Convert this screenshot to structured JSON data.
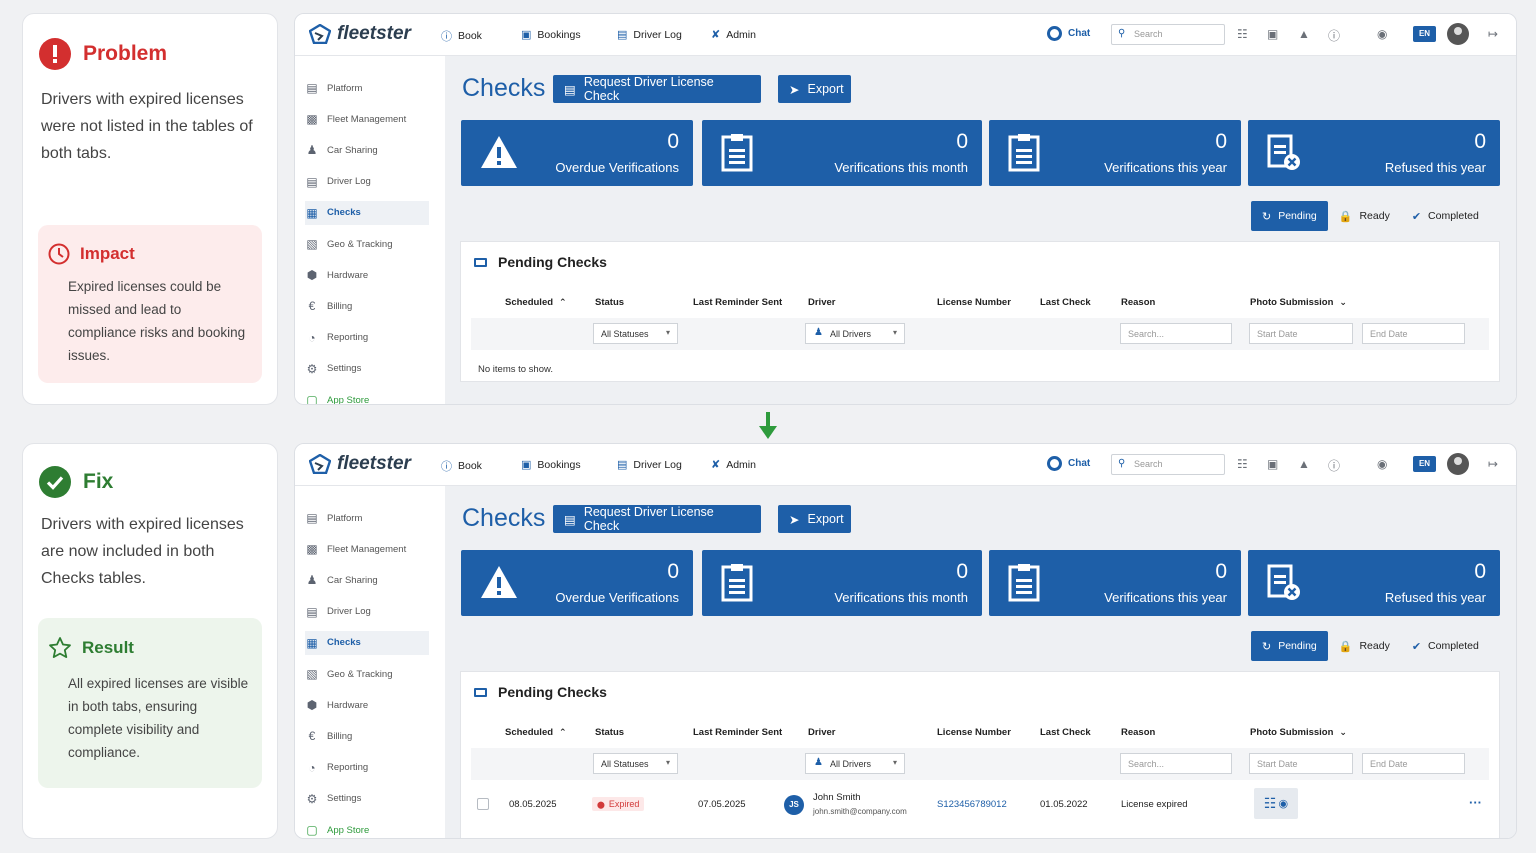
{
  "problem": {
    "title": "Problem",
    "body": "Drivers with expired licenses were not listed in the tables of both tabs.",
    "impact_title": "Impact",
    "impact_body": "Expired licenses could be missed and lead to compliance risks and booking issues."
  },
  "fix": {
    "title": "Fix",
    "body": "Drivers with expired licenses are now included in both Checks tables.",
    "result_title": "Result",
    "result_body": "All expired licenses are visible in both tabs, ensuring complete visibility and compliance."
  },
  "app": {
    "logo": "fleetster",
    "nav": [
      "Book",
      "Bookings",
      "Driver Log",
      "Admin"
    ],
    "chat": "Chat",
    "search_placeholder": "Search",
    "language": "EN",
    "sidebar": [
      "Platform",
      "Fleet Management",
      "Car Sharing",
      "Driver Log",
      "Checks",
      "Geo & Tracking",
      "Hardware",
      "Billing",
      "Reporting",
      "Settings",
      "App Store"
    ],
    "page_title": "Checks",
    "request_button": "Request Driver License Check",
    "export_button": "Export",
    "tiles": [
      {
        "value": "0",
        "label": "Overdue Verifications"
      },
      {
        "value": "0",
        "label": "Verifications this month"
      },
      {
        "value": "0",
        "label": "Verifications this year"
      },
      {
        "value": "0",
        "label": "Refused this year"
      }
    ],
    "tabs": [
      "Pending",
      "Ready",
      "Completed"
    ],
    "panel_title": "Pending Checks",
    "columns": [
      "Scheduled",
      "Status",
      "Last Reminder Sent",
      "Driver",
      "License Number",
      "Last Check",
      "Reason",
      "Photo Submission"
    ],
    "filters": {
      "status": "All Statuses",
      "driver": "All Drivers",
      "reason_placeholder": "Search...",
      "start_date": "Start Date",
      "end_date": "End Date"
    },
    "no_items": "No items to show."
  },
  "row": {
    "scheduled": "08.05.2025",
    "status": "Expired",
    "last_reminder": "07.05.2025",
    "initials": "JS",
    "driver_name": "John Smith",
    "driver_email": "john.smith@company.com",
    "license": "S123456789012",
    "last_check": "01.05.2022",
    "reason": "License expired",
    "more": "···"
  },
  "colors": {
    "primary": "#1e5fa8",
    "problem": "#d32f2f",
    "fix": "#2e7d32",
    "impact_bg": "#fdecec",
    "result_bg": "#edf5ec"
  }
}
